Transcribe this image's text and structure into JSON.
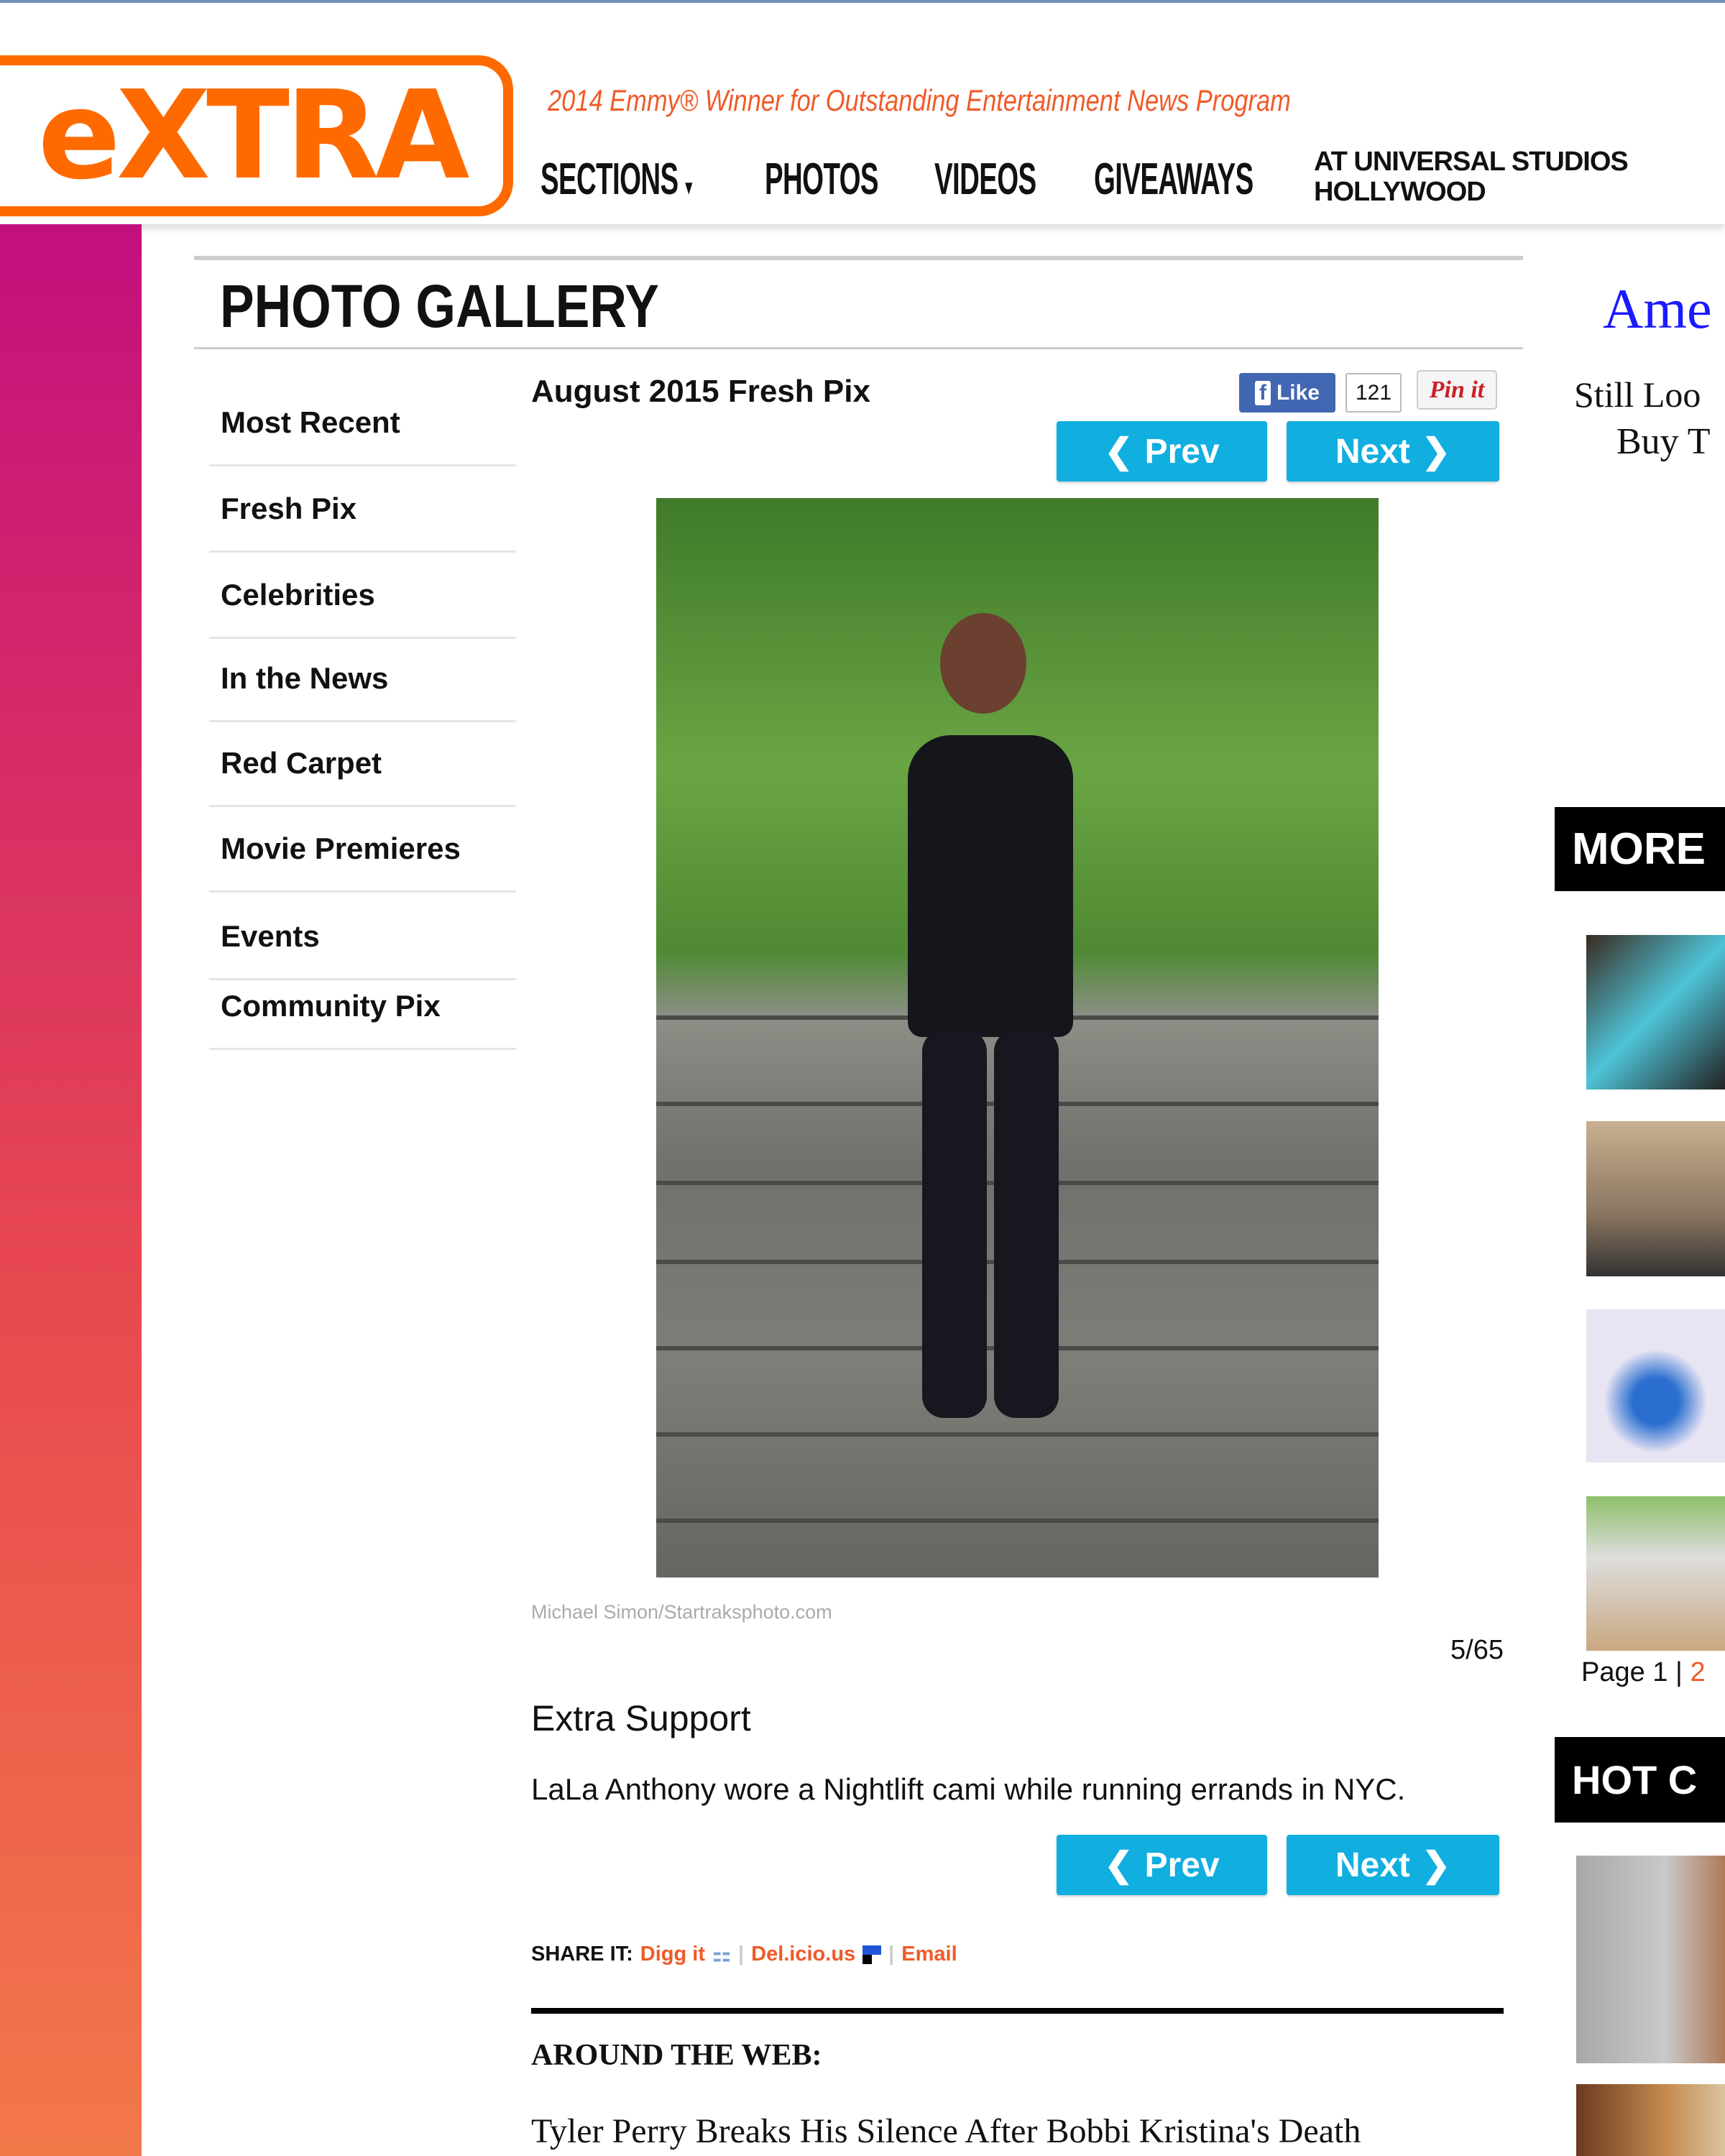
{
  "header": {
    "logo": "eXTRA",
    "tagline": "2014 Emmy® Winner for Outstanding Entertainment News Program",
    "nav": [
      "SECTIONS",
      "PHOTOS",
      "VIDEOS",
      "GIVEAWAYS",
      "AT UNIVERSAL STUDIOS HOLLYWOOD"
    ]
  },
  "page_title": "PHOTO GALLERY",
  "sidebar": [
    "Most Recent",
    "Fresh Pix",
    "Celebrities",
    "In the News",
    "Red Carpet",
    "Movie Premieres",
    "Events",
    "Community Pix"
  ],
  "gallery": {
    "title": "August 2015 Fresh Pix",
    "like": "Like",
    "like_count": "121",
    "pin": "Pin it",
    "prev": "Prev",
    "next": "Next",
    "credit": "Michael Simon/Startraksphoto.com",
    "counter": "5/65",
    "headline": "Extra Support",
    "caption": "LaLa Anthony wore a Nightlift cami while running errands in NYC."
  },
  "share": {
    "label": "SHARE IT:",
    "digg": "Digg it",
    "delicious": "Del.icio.us",
    "email": "Email"
  },
  "around": {
    "title": "AROUND THE WEB:",
    "first": "Tyler Perry Breaks His Silence After Bobbi Kristina's Death"
  },
  "right": {
    "ad_title": "Ame",
    "ad_line1": "Still Loo",
    "ad_line2": "Buy T",
    "more": "MORE",
    "page_label": "Page 1 |",
    "page2": "2",
    "hot": "HOT C"
  },
  "colors": {
    "brand": "#ff6a00",
    "button": "#11aee0",
    "link": "#f05a28"
  }
}
